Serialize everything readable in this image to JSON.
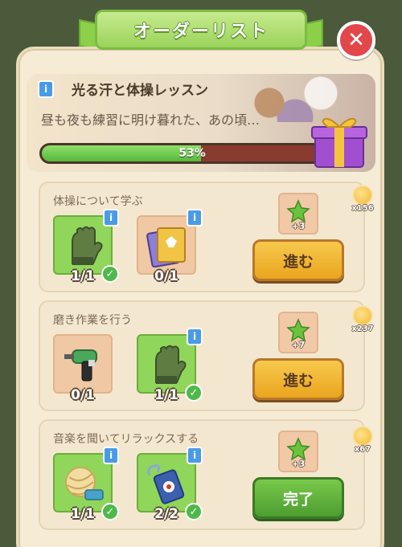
{
  "header": {
    "title": "オーダーリスト",
    "close_label": "✕"
  },
  "lesson": {
    "title": "光る汗と体操レッスン",
    "description": "昼も夜も練習に明け暮れた、あの頃…",
    "progress_percent": 53,
    "progress_label": "53%",
    "info_label": "i"
  },
  "tasks": [
    {
      "title": "体操について学ぶ",
      "items": [
        {
          "icon": "glove-icon",
          "count": "1/1",
          "done": true
        },
        {
          "icon": "book-icon",
          "count": "0/1",
          "done": false
        }
      ],
      "reward": "+3",
      "button": "進む",
      "coin": "x156"
    },
    {
      "title": "磨き作業を行う",
      "items": [
        {
          "icon": "drill-icon",
          "count": "0/1",
          "done": false
        },
        {
          "icon": "glove-icon",
          "count": "1/1",
          "done": true
        }
      ],
      "reward": "+7",
      "button": "進む",
      "coin": "x237"
    },
    {
      "title": "音楽を聞いてリラックスする",
      "items": [
        {
          "icon": "yarn-icon",
          "count": "1/1",
          "done": true
        },
        {
          "icon": "music-player-icon",
          "count": "2/2",
          "done": true
        }
      ],
      "reward": "+3",
      "button": "完了",
      "coin": "x67"
    }
  ],
  "colors": {
    "accent_green": "#8fd65a",
    "button_yellow": "#f2b934",
    "close_red": "#e2474a",
    "info_blue": "#4a9be6"
  }
}
